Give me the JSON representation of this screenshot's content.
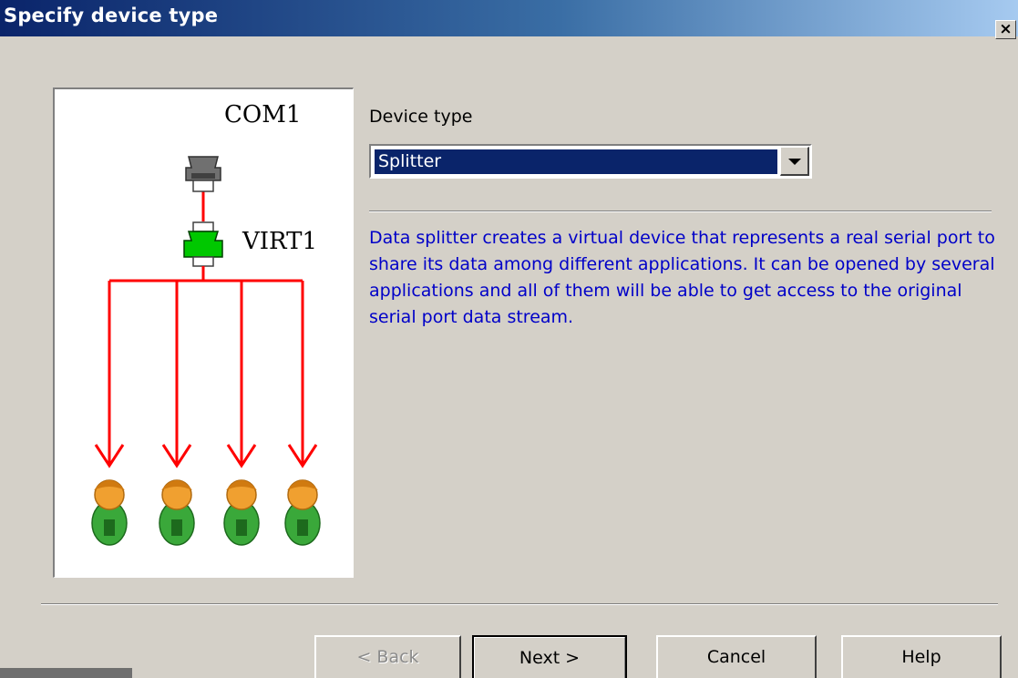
{
  "window": {
    "title": "Specify device type",
    "close_glyph": "×"
  },
  "diagram": {
    "com_label": "COM1",
    "virt_label": "VIRT1",
    "port_icon": "serial-port-icon",
    "virtual_port_icon": "virtual-port-icon",
    "user_icon": "user-icon",
    "user_count": 4,
    "colors": {
      "arrow": "#ff0000",
      "port_gray": "#707070",
      "port_green": "#00c800",
      "user_skin": "#f0a030",
      "user_shirt": "#3aa83a"
    }
  },
  "device_type": {
    "label": "Device type",
    "selected": "Splitter"
  },
  "description": "Data splitter creates a virtual device that represents a real serial port to share its data among different applications. It can be opened by several applications and all of them will be able to get access to the original serial port data stream.",
  "buttons": {
    "back": "< Back",
    "next": "Next >",
    "cancel": "Cancel",
    "help": "Help"
  },
  "colors": {
    "title_bar": "#0a246a",
    "description_text": "#0000c8",
    "dialog_background": "#d4d0c8"
  }
}
